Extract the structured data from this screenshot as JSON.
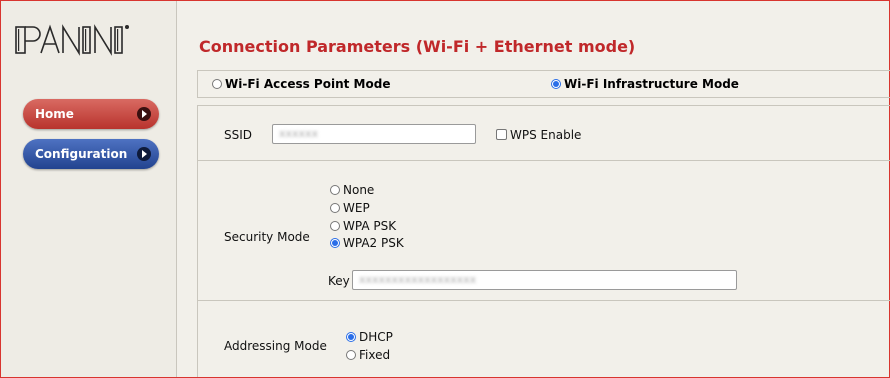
{
  "brand": {
    "logo_text": "PANINI"
  },
  "sidebar": {
    "items": [
      {
        "label": "Home"
      },
      {
        "label": "Configuration"
      }
    ]
  },
  "page": {
    "title": "Connection Parameters (Wi-Fi + Ethernet mode)"
  },
  "wifi_mode": {
    "options": [
      {
        "label": "Wi-Fi Access Point Mode",
        "selected": false
      },
      {
        "label": "Wi-Fi Infrastructure Mode",
        "selected": true
      }
    ]
  },
  "ssid": {
    "label": "SSID",
    "value": "xxxxxx",
    "wps_label": "WPS Enable",
    "wps_checked": false
  },
  "security": {
    "label": "Security Mode",
    "options": [
      {
        "label": "None",
        "selected": false
      },
      {
        "label": "WEP",
        "selected": false
      },
      {
        "label": "WPA PSK",
        "selected": false
      },
      {
        "label": "WPA2 PSK",
        "selected": true
      }
    ],
    "key_label": "Key",
    "key_value": "xxxxxxxxxxxxxxxxxx"
  },
  "addressing": {
    "label": "Addressing Mode",
    "options": [
      {
        "label": "DHCP",
        "selected": true
      },
      {
        "label": "Fixed",
        "selected": false
      }
    ]
  },
  "colors": {
    "title_red": "#c0282a",
    "home_button": "#c4443d",
    "config_button": "#2f52a3",
    "radio_selected": "#2a6ee8",
    "frame_border": "#d8352f"
  }
}
